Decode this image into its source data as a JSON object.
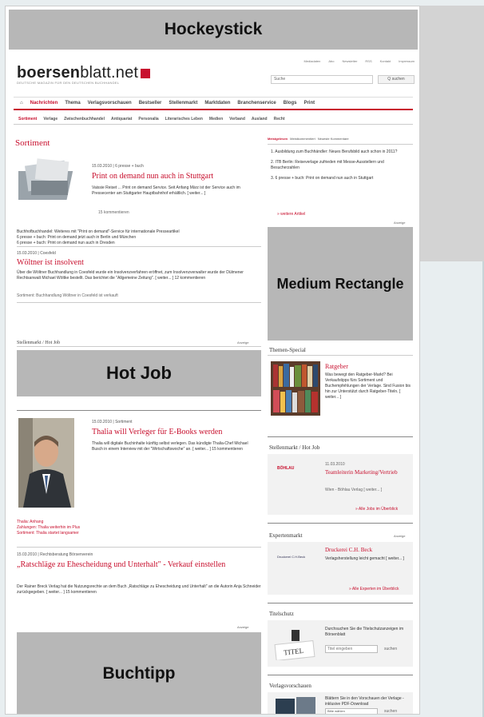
{
  "ads": {
    "hockeystick": "Hockeystick",
    "medium_rectangle": "Medium Rectangle",
    "hot_job": "Hot Job",
    "buchtipp": "Buchtipp"
  },
  "header": {
    "logo_bold": "boersen",
    "logo_rest": "blatt.net",
    "links": [
      "Mediadaten",
      "Abo",
      "Newsletter",
      "RSS",
      "Kontakt",
      "Impressum"
    ],
    "search_placeholder": "Suche",
    "search_button": "Q suchen"
  },
  "nav_main": [
    "Nachrichten",
    "Thema",
    "Verlagsvorschauen",
    "Bestseller",
    "Stellenmarkt",
    "Marktdaten",
    "Branchenservice",
    "Blogs",
    "Print"
  ],
  "nav_sub": [
    "Sortiment",
    "Verlage",
    "Zwischenbuchhandel",
    "Antiquariat",
    "Personalia",
    "Literarisches Leben",
    "Medien",
    "Verband",
    "Ausland",
    "Recht"
  ],
  "section": {
    "title": "Sortiment"
  },
  "article1": {
    "meta": "15.03.2010 | 6 presse + buch",
    "title": "Print on demand nun auch in Stuttgart",
    "text": "Vaissie Reiset ... Print on demand Service. Seit Anfang März ist der Service auch im Pressecenter am Stuttgarter Hauptbahnhof erhältlich. [ weiter... ]",
    "comments": "15 kommentieren"
  },
  "related": [
    "Buchhofbuchhandel: Weiteres mit \"Print on demand\"-Service für internationale Presseartikel",
    "6 presse + buch: Print on demand jetzt auch in Berlin und München",
    "6 presse + buch: Print on demand nun auch in Dresden"
  ],
  "article2": {
    "meta": "15.03.2010 | Coesfeld",
    "title": "Wöltner ist insolvent",
    "text": "Über die Wöltner Buchhandlung in Coesfeld wurde ein Insolvenzverfahren eröffnet, zum Insolvenzverwalter wurde der Dülmener Rechtsanwalt Michael Wöltke bestellt. Das berichtet die \"Allgemeine Zeitung\". [ weiter... ] 12 kommentieren",
    "footer": "Sortiment: Buchhandlung Wöltner in Coesfeld ist verkauft"
  },
  "stellenmarkt": {
    "label": "Stellenmarkt / Hot Job",
    "anzeige": "Anzeige"
  },
  "article3": {
    "meta": "15.03.2010 | Sortiment",
    "title": "Thalia will Verleger für E-Books werden",
    "text": "Thalia will digitale Buchinhalte künftig selbst verlegen. Das kündigte Thalia-Chef Michael Busch in einem Interview mit der \"Wirtschaftswoche\" an. [ weiter... ] 15 kommentieren",
    "links": [
      "Thalia: Anhang",
      "Zahlungen: Thalia weiterhin im Plus",
      "Sortiment: Thalia startet langsamer"
    ]
  },
  "article4": {
    "meta": "15.03.2010 | Rechtsberatung Börsenverein",
    "title": "„Ratschläge zu Ehescheidung und Unterhalt\" - Verkauf einstellen",
    "text": "Der Rainer Breck Verlag hat die Nutzungsrechte an dem Buch „Ratschläge zu Ehescheidung und Unterhalt\" an die Autorin Anja Schneider zurückgegeben. [ weiter... ] 15 kommentieren"
  },
  "anzeige": "Anzeige",
  "right": {
    "tabs": [
      "Meistgelesen",
      "Meistkommentiert",
      "Neueste Kommentare"
    ],
    "top": [
      "1. Ausbildung zum Buchhändler: Neues Berufsbild auch schon in 2011?",
      "2. ITB Berlin: Reiseverlage zufrieden mit Messe-Ausstellern und Besucherzahlen",
      "3. 6 presse + buch: Print on demand nun auch in Stuttgart"
    ],
    "more": "» weitere Artikel",
    "themen_special": {
      "title": "Themen-Special",
      "item_title": "Ratgeber",
      "item_text": "Was bewegt den Ratgeber-Markt? Bei Verkaufstipps fürs Sortiment und Buchempfehlungen der Verlage. Sind Fusion bis hin zur Unterstützt durch Ratgeber-Titeln. [ weiter... ]"
    },
    "hotjob": {
      "title": "Stellenmarkt / Hot Job",
      "company": "BÖHLAU",
      "date": "11.03.2010",
      "job": "Teamleiterin Marketing/Vertrieb",
      "place": "Wien - Böhlau Verlag [ weiter... ]",
      "more": "» Alle Jobs im Überblick"
    },
    "experten": {
      "title": "Expertenmarkt",
      "anzeige": "Anzeige",
      "logo": "Druckerei C.H.Beck",
      "name": "Druckerei C.H. Beck",
      "text": "Verlagsherstellung leicht gemacht [ weiter... ]",
      "more": "» Alle Experten im Überblick"
    },
    "titelschutz": {
      "title": "Titelschutz",
      "text": "Durchsuchen Sie die Titelschutzanzeigen im Börsenblatt",
      "input": "Titel eingeben",
      "button": "suchen"
    },
    "vorschauen": {
      "title": "Verlagsvorschauen",
      "text": "Blättern Sie in den Vorschauen der Verlage - inklusive PDF-Download",
      "select": "Bitte wählen",
      "button": "suchen"
    }
  }
}
